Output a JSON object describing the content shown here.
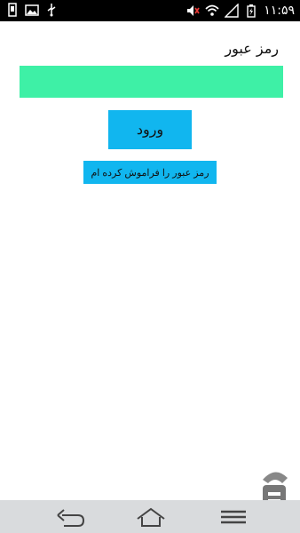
{
  "status_bar": {
    "time": "۱۱:۵۹",
    "left_icons": [
      "usb-debug-icon",
      "image-icon",
      "usb-icon"
    ],
    "right_icons": [
      "volume-mute-icon",
      "wifi-icon",
      "signal-icon",
      "battery-icon"
    ]
  },
  "login": {
    "password_label": "رمز عبور",
    "password_value": "",
    "login_button_label": "ورود",
    "forgot_password_label": "رمز عبور را فراموش کرده ام"
  },
  "colors": {
    "field": "#3ef0a6",
    "button": "#11b6ef",
    "navbar": "#d9dbdd"
  },
  "nav_bar": {
    "buttons": [
      "back-icon",
      "home-icon",
      "menu-icon"
    ]
  }
}
